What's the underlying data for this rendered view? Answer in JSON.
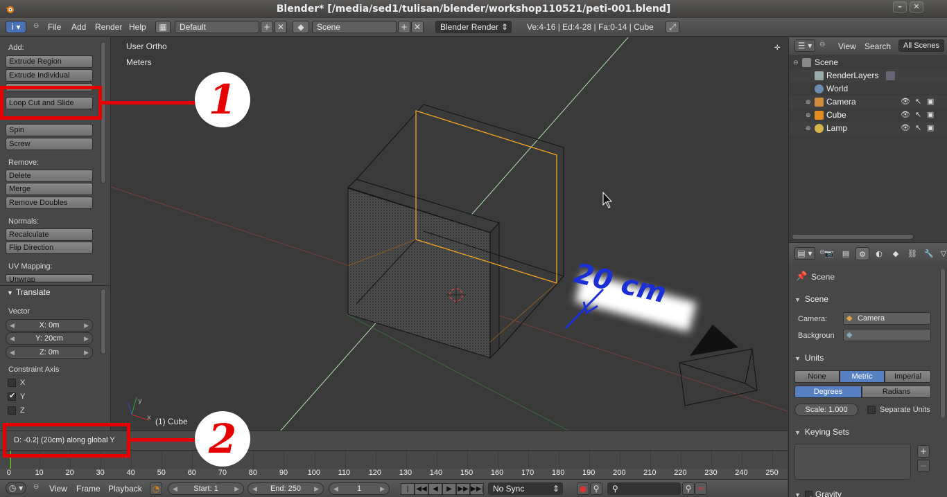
{
  "window": {
    "title": "Blender* [/media/sed1/tulisan/blender/workshop110521/peti-001.blend]"
  },
  "infobar": {
    "menus": [
      "File",
      "Add",
      "Render",
      "Help"
    ],
    "screen_layout": "Default",
    "scene": "Scene",
    "render_engine": "Blender Render",
    "stats": "Ve:4-16 | Ed:4-28 | Fa:0-14 | Cube"
  },
  "toolshelf": {
    "add_label": "Add:",
    "add_buttons": [
      "Extrude Region",
      "Extrude Individual",
      "Loop Cut and Slide",
      "Spin",
      "Screw"
    ],
    "remove_label": "Remove:",
    "remove_buttons": [
      "Delete",
      "Merge",
      "Remove Doubles"
    ],
    "normals_label": "Normals:",
    "normals_buttons": [
      "Recalculate",
      "Flip Direction"
    ],
    "uv_label": "UV Mapping:",
    "uv_button": "Unwrap"
  },
  "operator": {
    "title": "Translate",
    "vector_label": "Vector",
    "x": "X: 0m",
    "y": "Y: 20cm",
    "z": "Z: 0m",
    "constraint_label": "Constraint Axis",
    "axes": [
      {
        "label": "X",
        "checked": false
      },
      {
        "label": "Y",
        "checked": true
      },
      {
        "label": "Z",
        "checked": false
      }
    ]
  },
  "viewport": {
    "view_name": "User Ortho",
    "units": "Meters",
    "object_label": "(1) Cube",
    "annotation_text": "20 cm"
  },
  "status": {
    "message": "D: -0.2| (20cm) along global Y"
  },
  "annotations": {
    "badge1": "1",
    "badge2": "2"
  },
  "timeline": {
    "ticks": [
      "0",
      "10",
      "20",
      "30",
      "40",
      "50",
      "60",
      "70",
      "80",
      "90",
      "100",
      "110",
      "120",
      "130",
      "140",
      "150",
      "160",
      "170",
      "180",
      "190",
      "200",
      "210",
      "220",
      "230",
      "240",
      "250"
    ],
    "menus": [
      "View",
      "Frame",
      "Playback"
    ],
    "start": "Start: 1",
    "end": "End: 250",
    "current": "1",
    "sync": "No Sync"
  },
  "outliner": {
    "menus": [
      "View",
      "Search"
    ],
    "filter": "All Scenes",
    "items": [
      {
        "label": "Scene",
        "indent": 0
      },
      {
        "label": "RenderLayers",
        "indent": 1
      },
      {
        "label": "World",
        "indent": 1
      },
      {
        "label": "Camera",
        "indent": 1
      },
      {
        "label": "Cube",
        "indent": 1
      },
      {
        "label": "Lamp",
        "indent": 1
      }
    ]
  },
  "properties": {
    "breadcrumb": "Scene",
    "scene_section": "Scene",
    "camera_label": "Camera:",
    "camera_value": "Camera",
    "background_label": "Backgroun",
    "units_section": "Units",
    "unit_systems": [
      "None",
      "Metric",
      "Imperial"
    ],
    "unit_selected": "Metric",
    "rotation_units": [
      "Degrees",
      "Radians"
    ],
    "rotation_selected": "Degrees",
    "scale": "Scale: 1.000",
    "separate_units": "Separate Units",
    "keying_sets": "Keying Sets",
    "gravity": "Gravity"
  },
  "colors": {
    "accent_blue": "#5680c2",
    "annotation_red": "#e60000",
    "selection_orange": "#f5a623",
    "handwriting_blue": "#1a2fd6"
  }
}
